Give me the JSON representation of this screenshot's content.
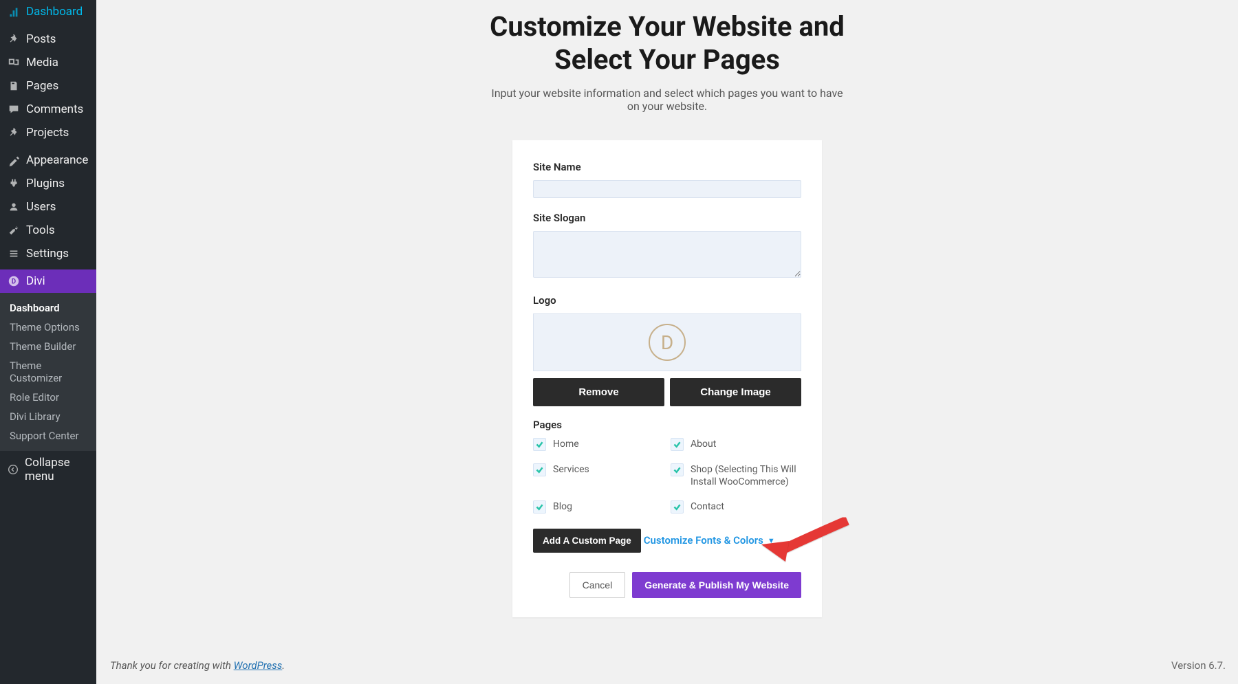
{
  "sidebar": {
    "items": [
      {
        "label": "Dashboard",
        "icon": "dashboard"
      },
      {
        "label": "Posts",
        "icon": "pin"
      },
      {
        "label": "Media",
        "icon": "media"
      },
      {
        "label": "Pages",
        "icon": "pages"
      },
      {
        "label": "Comments",
        "icon": "comments"
      },
      {
        "label": "Projects",
        "icon": "projects"
      },
      {
        "label": "Appearance",
        "icon": "appearance"
      },
      {
        "label": "Plugins",
        "icon": "plugins"
      },
      {
        "label": "Users",
        "icon": "users"
      },
      {
        "label": "Tools",
        "icon": "tools"
      },
      {
        "label": "Settings",
        "icon": "settings"
      },
      {
        "label": "Divi",
        "icon": "divi",
        "active": true
      }
    ],
    "submenu": [
      "Dashboard",
      "Theme Options",
      "Theme Builder",
      "Theme Customizer",
      "Role Editor",
      "Divi Library",
      "Support Center"
    ],
    "collapse": "Collapse menu"
  },
  "heading": {
    "line1": "Customize Your Website and",
    "line2": "Select Your Pages"
  },
  "subheading": "Input your website information and select which pages you want to have on your website.",
  "form": {
    "site_name_label": "Site Name",
    "site_slogan_label": "Site Slogan",
    "logo_label": "Logo",
    "logo_letter": "D",
    "remove_btn": "Remove",
    "change_image_btn": "Change Image",
    "pages_label": "Pages",
    "pages": [
      {
        "label": "Home",
        "checked": true
      },
      {
        "label": "About",
        "checked": true
      },
      {
        "label": "Services",
        "checked": true
      },
      {
        "label": "Shop (Selecting This Will Install WooCommerce)",
        "checked": true
      },
      {
        "label": "Blog",
        "checked": true
      },
      {
        "label": "Contact",
        "checked": true
      }
    ],
    "add_custom_page": "Add A Custom Page",
    "customize_colors": "Customize Fonts & Colors",
    "cancel": "Cancel",
    "generate": "Generate & Publish My Website"
  },
  "footer": {
    "thanks_prefix": "Thank you for creating with ",
    "wordpress": "WordPress",
    "thanks_suffix": ".",
    "version": "Version 6.7."
  }
}
